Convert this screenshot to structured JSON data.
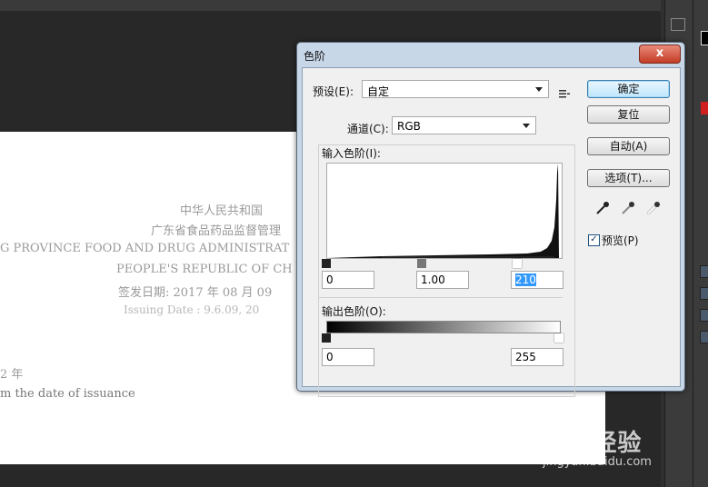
{
  "document": {
    "lines": [
      "中华人民共和国",
      "广东省食品药品监督管理",
      "G PROVINCE FOOD AND DRUG ADMINISTRAT",
      "PEOPLE'S REPUBLIC OF CH",
      "签发日期: 2017 年 08 月 09",
      "Issuing Date : 9.6.09, 20",
      "2 年",
      "m the date of issuance"
    ]
  },
  "dialog": {
    "title": "色阶",
    "close_label": "x",
    "preset": {
      "label": "预设(E):",
      "value": "自定",
      "menu_icon": "preset-options-icon"
    },
    "channel": {
      "label": "通道(C):",
      "value": "RGB"
    },
    "input_levels": {
      "label": "输入色阶(I):",
      "shadow": "0",
      "midtone": "1.00",
      "highlight": "210"
    },
    "output_levels": {
      "label": "输出色阶(O):",
      "shadow": "0",
      "highlight": "255"
    },
    "buttons": {
      "ok": "确定",
      "reset": "复位",
      "auto": "自动(A)",
      "options": "选项(T)..."
    },
    "eyedroppers": [
      "black-eyedropper-icon",
      "gray-eyedropper-icon",
      "white-eyedropper-icon"
    ],
    "preview": {
      "label": "预览(P)",
      "checked": true
    }
  },
  "watermark": {
    "text": "Bai 经验",
    "url": "jingyan.baidu.com"
  }
}
